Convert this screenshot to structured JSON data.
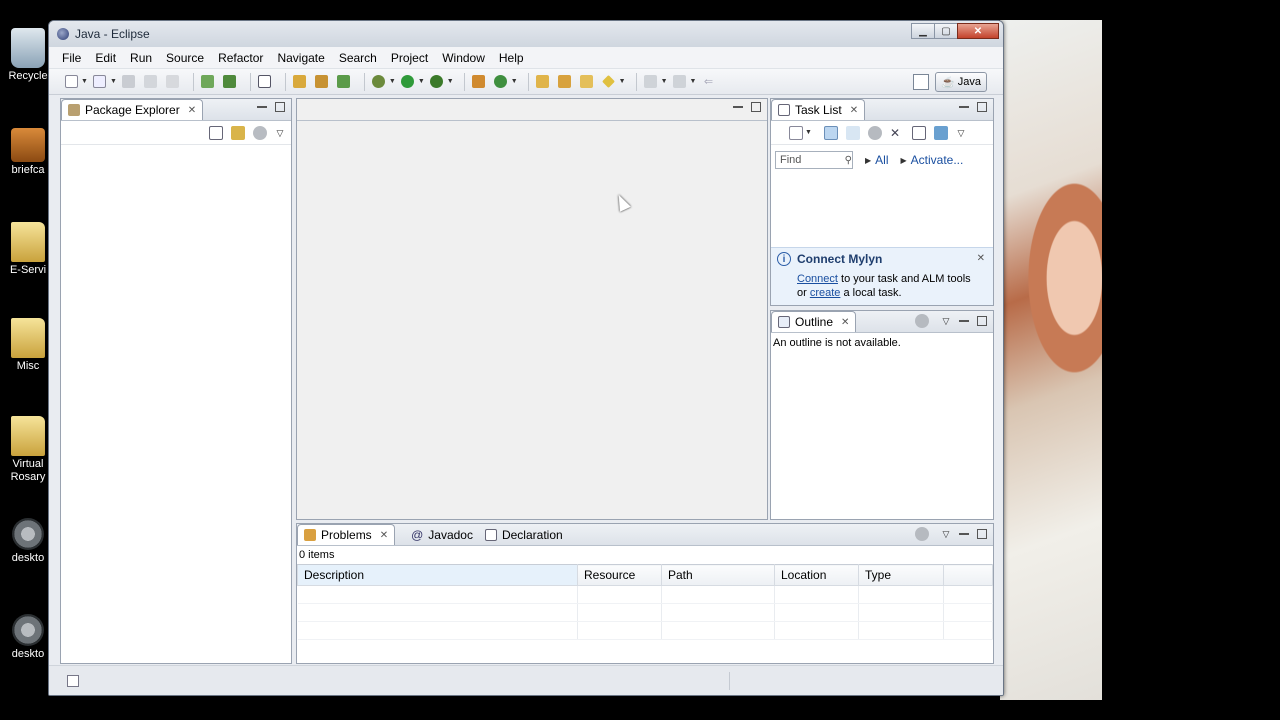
{
  "window": {
    "title": "Java - Eclipse"
  },
  "desktop": {
    "icons": [
      {
        "label": "Recycle",
        "icon": "recycle-bin-icon"
      },
      {
        "label": "briefca",
        "icon": "briefcase-icon"
      },
      {
        "label": "E-Servi",
        "icon": "folder-icon"
      },
      {
        "label": "Misc",
        "icon": "folder-icon"
      },
      {
        "label": "Virtual Rosary",
        "icon": "folder-icon"
      },
      {
        "label": "deskto",
        "icon": "gear-icon"
      },
      {
        "label": "deskto",
        "icon": "gear-icon"
      }
    ]
  },
  "menubar": [
    "File",
    "Edit",
    "Run",
    "Source",
    "Refactor",
    "Navigate",
    "Search",
    "Project",
    "Window",
    "Help"
  ],
  "perspective": {
    "label": "Java"
  },
  "package_explorer": {
    "tab_label": "Package Explorer"
  },
  "task_list": {
    "tab_label": "Task List",
    "find_placeholder": "Find",
    "all_label": "All",
    "activate_label": "Activate..."
  },
  "mylyn": {
    "title": "Connect Mylyn",
    "connect_link": "Connect",
    "line1_rest": " to your task and ALM tools",
    "or_text": "or ",
    "create_link": "create",
    "line2_rest": " a local task."
  },
  "outline": {
    "tab_label": "Outline",
    "message": "An outline is not available."
  },
  "bottom_tabs": {
    "problems": "Problems",
    "javadoc": "Javadoc",
    "declaration": "Declaration"
  },
  "problems": {
    "count": "0 items",
    "columns": [
      "Description",
      "Resource",
      "Path",
      "Location",
      "Type"
    ]
  },
  "colors": {
    "link": "#1a4fa0",
    "mylyn_bg": "#eaf2fb",
    "close_button": "#c3432c"
  }
}
